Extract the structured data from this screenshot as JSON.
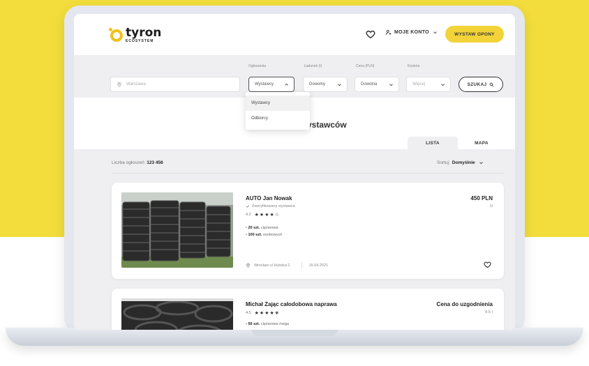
{
  "colors": {
    "brand_yellow": "#f2dd3c",
    "cta_yellow": "#f2d338",
    "band_gray": "#efeff1"
  },
  "header": {
    "logo_text": "tyron",
    "logo_sub": "ECOSYSTEM",
    "account_label": "MOJE KONTO",
    "cta_label": "WYSTAW OPONY",
    "icons": [
      "heart-icon",
      "user-icon",
      "chevron-down-icon"
    ]
  },
  "search": {
    "location_placeholder": "Warszawa",
    "filters": [
      {
        "label": "Ogłoszenia",
        "value": "Wystawcy"
      },
      {
        "label": "Ładunek (t)",
        "value": "Dowolny"
      },
      {
        "label": "Cena (PLN)",
        "value": "Dowolna"
      },
      {
        "label": "Kryteria",
        "value": "Więcej"
      }
    ],
    "search_button": "SZUKAJ"
  },
  "dropdown": {
    "options": [
      "Wystawcy",
      "Odbiorcy"
    ],
    "selected": "Wystawcy"
  },
  "page": {
    "title_fragment": "ystawców"
  },
  "tabs": [
    {
      "label": "LISTA",
      "active": true
    },
    {
      "label": "MAPA",
      "active": false
    }
  ],
  "results": {
    "count_label": "Liczba ogłoszeń:",
    "count_value": "123 456",
    "sort_label": "Sortuj:",
    "sort_value": "Domyślnie"
  },
  "listings": [
    {
      "title": "AUTO Jan Nowak",
      "verified": "Zweryfikowany wystawca",
      "rating": "4.2",
      "stars": "★★★★☆",
      "bullets": [
        {
          "qty": "20 szt.",
          "type": "ciężarowa"
        },
        {
          "qty": "100 szt.",
          "type": "osobowych"
        }
      ],
      "price": "450 PLN",
      "unit": "1t",
      "location": "Wrocław ul Hubska 2",
      "date": "15.04.2021"
    },
    {
      "title": "Michał Zając całodobowa naprawa",
      "rating": "4.5",
      "stars": "★★★★✬",
      "bullets": [
        {
          "qty": "50 szt.",
          "type": "ciężarowa mega"
        }
      ],
      "price": "Cena do uzgodnienia",
      "unit": "8,5 t"
    }
  ]
}
